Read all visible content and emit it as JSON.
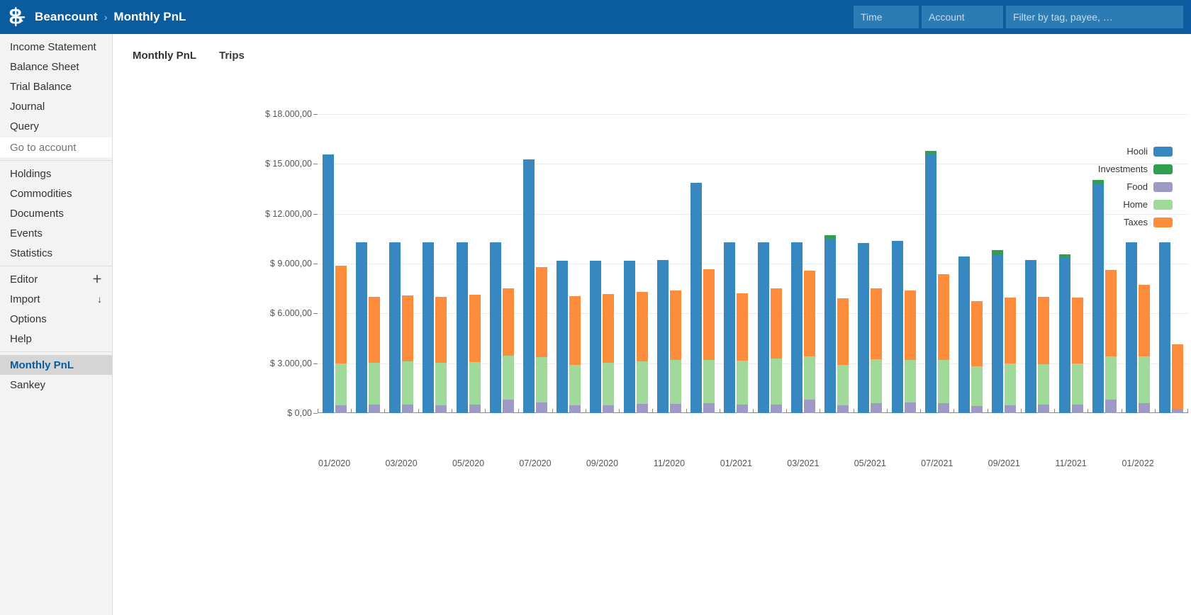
{
  "header": {
    "logo_icon": "beancount-logo-icon",
    "brand": "Beancount",
    "separator": "›",
    "current_page": "Monthly PnL",
    "time_placeholder": "Time",
    "account_placeholder": "Account",
    "tag_placeholder": "Filter by tag, payee, …",
    "time_value": "",
    "account_value": "",
    "tag_value": "",
    "background": "#0a5c9e",
    "field_background": "#2b7cb5"
  },
  "sidebar": {
    "groups": [
      {
        "items": [
          {
            "label": "Income Statement",
            "badge": ""
          },
          {
            "label": "Balance Sheet",
            "badge": ""
          },
          {
            "label": "Trial Balance",
            "badge": ""
          },
          {
            "label": "Journal",
            "badge": ""
          },
          {
            "label": "Query",
            "badge": ""
          }
        ],
        "goto_account": "Go to account"
      },
      {
        "items": [
          {
            "label": "Holdings",
            "badge": ""
          },
          {
            "label": "Commodities",
            "badge": ""
          },
          {
            "label": "Documents",
            "badge": ""
          },
          {
            "label": "Events",
            "badge": ""
          },
          {
            "label": "Statistics",
            "badge": ""
          }
        ]
      },
      {
        "items": [
          {
            "label": "Editor",
            "badge": "＋"
          },
          {
            "label": "Import",
            "badge": "↓"
          },
          {
            "label": "Options",
            "badge": ""
          },
          {
            "label": "Help",
            "badge": ""
          }
        ]
      },
      {
        "items": [
          {
            "label": "Monthly PnL",
            "badge": "",
            "active": true
          },
          {
            "label": "Sankey",
            "badge": ""
          }
        ]
      }
    ],
    "active_color": "#0a5c9e",
    "active_background": "#d5d5d5"
  },
  "main": {
    "tabs": [
      {
        "label": "Monthly PnL",
        "active": true
      },
      {
        "label": "Trips",
        "active": false
      }
    ]
  },
  "chart_data": {
    "type": "bar",
    "subtype": "grouped-stacked",
    "title": "Monthly PnL",
    "xlabel": "",
    "ylabel": "",
    "ylim": [
      0,
      18000
    ],
    "yticks": [
      0,
      3000,
      6000,
      9000,
      12000,
      15000,
      18000
    ],
    "ytick_labels": [
      "$ 0,00",
      "$ 3.000,00",
      "$ 6.000,00",
      "$ 9.000,00",
      "$ 12.000,00",
      "$ 15.000,00",
      "$ 18.000,00"
    ],
    "grid": true,
    "legend_position": "right",
    "currency_symbol": "$",
    "legend": [
      {
        "name": "Hooli",
        "color": "#3787c0"
      },
      {
        "name": "Investments",
        "color": "#2e9e4f"
      },
      {
        "name": "Food",
        "color": "#9e9ac8"
      },
      {
        "name": "Home",
        "color": "#a1d99b"
      },
      {
        "name": "Taxes",
        "color": "#fd8d3c"
      }
    ],
    "categories": [
      "01/2020",
      "02/2020",
      "03/2020",
      "04/2020",
      "05/2020",
      "06/2020",
      "07/2020",
      "08/2020",
      "09/2020",
      "10/2020",
      "11/2020",
      "12/2020",
      "01/2021",
      "02/2021",
      "03/2021",
      "04/2021",
      "05/2021",
      "06/2021",
      "07/2021",
      "08/2021",
      "09/2021",
      "10/2021",
      "11/2021",
      "12/2021",
      "01/2022",
      "02/2022"
    ],
    "xtick_labels": [
      "01/2020",
      "03/2020",
      "05/2020",
      "07/2020",
      "09/2020",
      "11/2020",
      "01/2021",
      "03/2021",
      "05/2021",
      "07/2021",
      "09/2021",
      "11/2021",
      "01/2022"
    ],
    "series": [
      {
        "name": "Hooli",
        "group": "income",
        "color": "#3787c0",
        "values": [
          15560,
          10300,
          10300,
          10300,
          10300,
          10300,
          15250,
          9180,
          9180,
          9180,
          9200,
          13880,
          10300,
          10300,
          10300,
          10500,
          10250,
          10350,
          15580,
          9430,
          9500,
          9200,
          9380,
          13820,
          10300,
          10300
        ]
      },
      {
        "name": "Investments",
        "group": "income",
        "color": "#2e9e4f",
        "values": [
          0,
          0,
          0,
          0,
          0,
          0,
          0,
          0,
          0,
          0,
          0,
          0,
          0,
          0,
          0,
          200,
          0,
          0,
          200,
          0,
          300,
          0,
          180,
          200,
          0,
          0
        ]
      },
      {
        "name": "Food",
        "group": "expense",
        "color": "#9e9ac8",
        "values": [
          450,
          500,
          520,
          480,
          500,
          800,
          650,
          450,
          480,
          560,
          560,
          600,
          500,
          520,
          800,
          450,
          580,
          620,
          580,
          420,
          480,
          500,
          500,
          800,
          600,
          250
        ]
      },
      {
        "name": "Home",
        "group": "expense",
        "color": "#a1d99b",
        "values": [
          2520,
          2530,
          2580,
          2560,
          2580,
          2650,
          2700,
          2470,
          2540,
          2540,
          2660,
          2600,
          2640,
          2750,
          2600,
          2450,
          2660,
          2600,
          2640,
          2380,
          2500,
          2450,
          2470,
          2620,
          2830,
          0
        ]
      },
      {
        "name": "Taxes",
        "group": "expense",
        "color": "#fd8d3c",
        "values": [
          5900,
          3970,
          4000,
          3950,
          4040,
          4060,
          5440,
          4120,
          4160,
          4180,
          4140,
          5480,
          4080,
          4230,
          5180,
          4030,
          4260,
          4180,
          5140,
          3930,
          3990,
          4060,
          3990,
          5190,
          4280,
          3900
        ]
      }
    ]
  }
}
